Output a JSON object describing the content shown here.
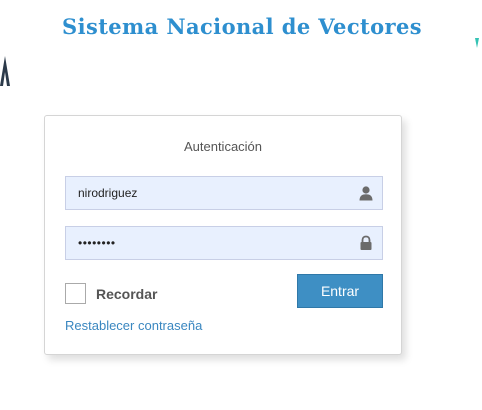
{
  "header": {
    "title": "Sistema Nacional de Vectores"
  },
  "login": {
    "heading": "Autenticación",
    "username": {
      "value": "nirodriguez",
      "icon": "user-icon"
    },
    "password": {
      "value": "••••••••",
      "icon": "lock-icon"
    },
    "remember_label": "Recordar",
    "remember_checked": false,
    "submit_label": "Entrar",
    "reset_link_label": "Restablecer contraseña"
  },
  "colors": {
    "title": "#2e8fcf",
    "button": "#3e8fc4",
    "field_bg": "#e8f0fe",
    "link": "#3a87c0"
  }
}
